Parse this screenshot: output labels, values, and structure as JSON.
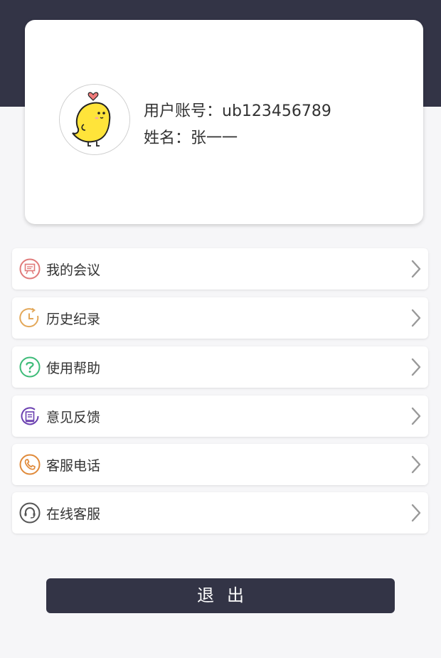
{
  "profile": {
    "avatar_icon": "chick-avatar-icon",
    "account_label": "用户账号：",
    "account_value": "ub123456789",
    "name_label": "姓名：",
    "name_value": "张一一"
  },
  "menu": {
    "items": [
      {
        "label": "我的会议",
        "icon": "meeting-icon",
        "color": "#e07a7a"
      },
      {
        "label": "历史纪录",
        "icon": "history-icon",
        "color": "#e3a85a"
      },
      {
        "label": "使用帮助",
        "icon": "help-icon",
        "color": "#3dbb78"
      },
      {
        "label": "意见反馈",
        "icon": "feedback-icon",
        "color": "#6a3fb0"
      },
      {
        "label": "客服电话",
        "icon": "phone-icon",
        "color": "#e08a3a"
      },
      {
        "label": "在线客服",
        "icon": "headset-icon",
        "color": "#555555"
      }
    ]
  },
  "logout_label": "退出",
  "colors": {
    "header_bg": "#333446",
    "page_bg": "#f6f6f8",
    "button_bg": "#333446"
  }
}
